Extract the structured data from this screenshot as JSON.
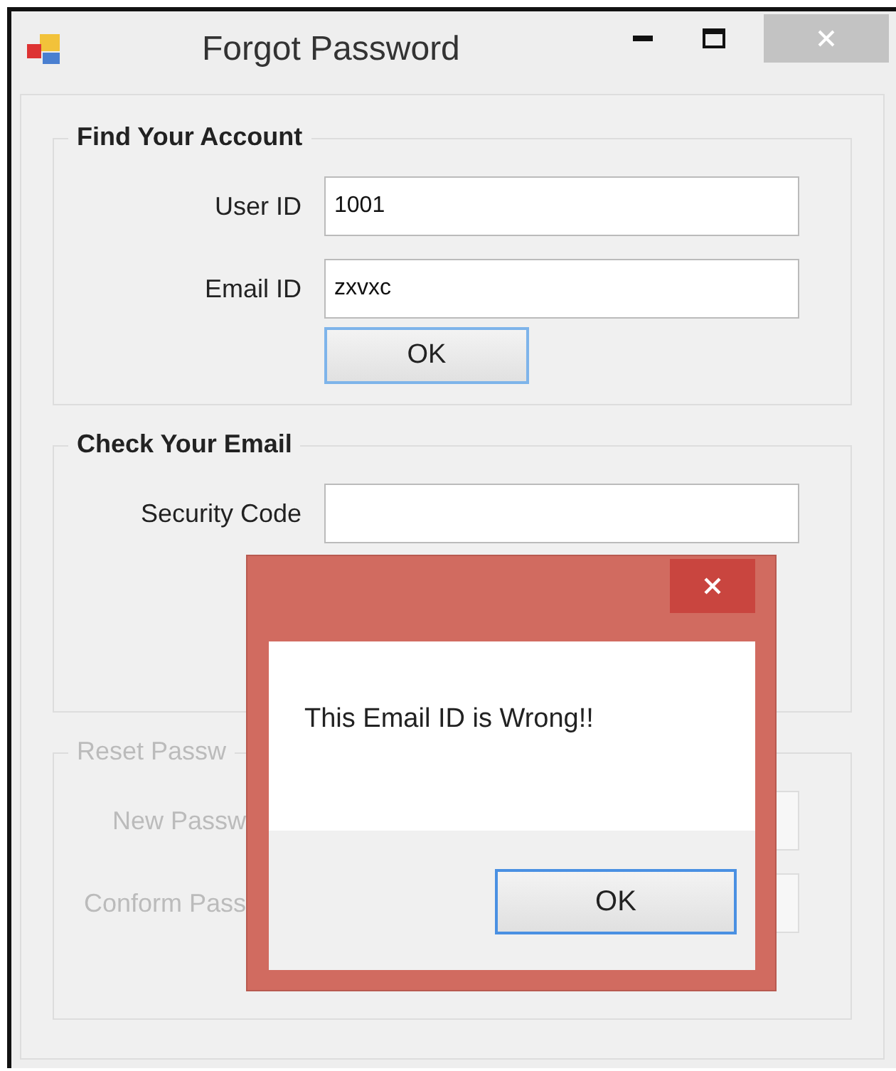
{
  "window": {
    "title": "Forgot Password"
  },
  "groups": [
    {
      "legend": "Find Your Account",
      "disabled": false,
      "fields": [
        {
          "label": "User ID",
          "value": "1001"
        },
        {
          "label": "Email ID",
          "value": "zxvxc"
        }
      ],
      "button": "OK"
    },
    {
      "legend": "Check Your Email",
      "disabled": false,
      "fields": [
        {
          "label": "Security Code"
        }
      ]
    },
    {
      "legend": "Reset Passw",
      "disabled": true,
      "fields": [
        {
          "label": "New Passw"
        },
        {
          "label": "Conform Pass"
        }
      ]
    }
  ],
  "dialog": {
    "message": "This Email ID is Wrong!!",
    "button": "OK"
  }
}
